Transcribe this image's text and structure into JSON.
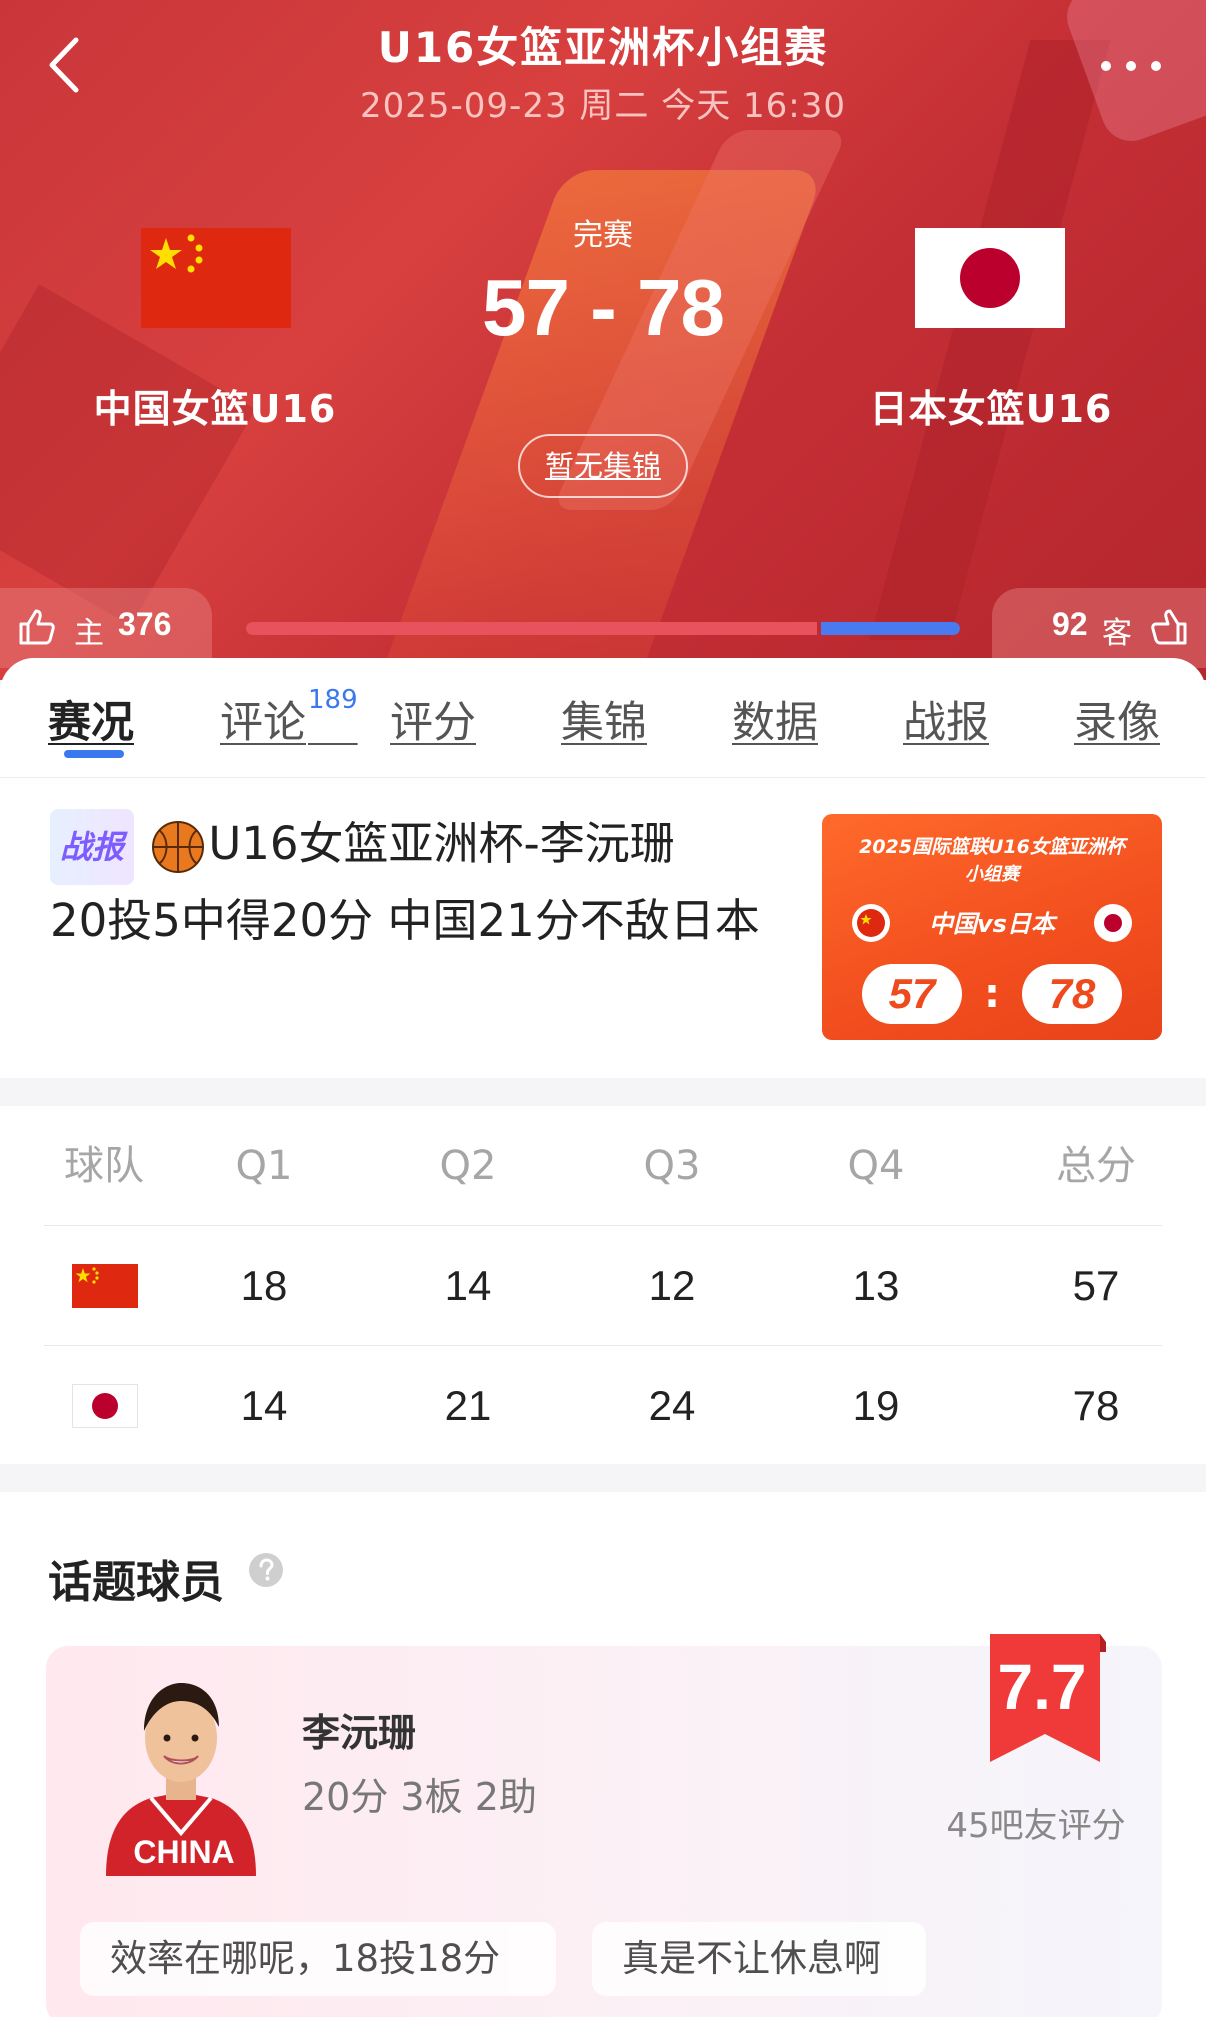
{
  "header": {
    "title": "U16女篮亚洲杯小组赛",
    "datetime": "2025-09-23 周二 今天 16:30"
  },
  "match": {
    "status": "完赛",
    "score": "57 - 78",
    "home_team": "中国女篮U16",
    "away_team": "日本女篮U16",
    "highlights_label": "暂无集锦"
  },
  "votes": {
    "home_label": "主",
    "home_count": "376",
    "away_label": "客",
    "away_count": "92",
    "home_share": 0.803
  },
  "tabs": [
    {
      "label": "赛况",
      "active": true
    },
    {
      "label": "评论",
      "badge": "189"
    },
    {
      "label": "评分"
    },
    {
      "label": "集锦"
    },
    {
      "label": "数据"
    },
    {
      "label": "战报"
    },
    {
      "label": "录像"
    }
  ],
  "report": {
    "badge": "战报",
    "title_part1": "U16女篮亚洲杯-李沅珊",
    "title_part2": "20投5中得20分 中国21分不敌日本",
    "thumb": {
      "line1": "2025国际篮联U16女篮亚洲杯",
      "line2": "小组赛",
      "vs": "中国vs日本",
      "home_score": "57",
      "colon": ":",
      "away_score": "78"
    }
  },
  "boxscore": {
    "headers": [
      "球队",
      "Q1",
      "Q2",
      "Q3",
      "Q4",
      "总分"
    ],
    "rows": [
      {
        "team_flag": "china-flag",
        "q": [
          "18",
          "14",
          "12",
          "13"
        ],
        "total": "57"
      },
      {
        "team_flag": "japan-flag",
        "q": [
          "14",
          "21",
          "24",
          "19"
        ],
        "total": "78"
      }
    ]
  },
  "hot_players": {
    "section_title": "话题球员",
    "player": {
      "name": "李沅珊",
      "stats": "20分 3板 2助",
      "rating": "7.7",
      "rating_count": "45吧友评分",
      "jersey_text": "CHINA"
    },
    "comments": [
      "效率在哪呢，18投18分",
      "真是不让休息啊"
    ]
  },
  "colors": {
    "header_red": "#c9363a",
    "accent_blue": "#3a78f0",
    "home_bar": "#e8525d",
    "away_bar": "#4a7af0",
    "rating_red": "#f03a3a"
  }
}
